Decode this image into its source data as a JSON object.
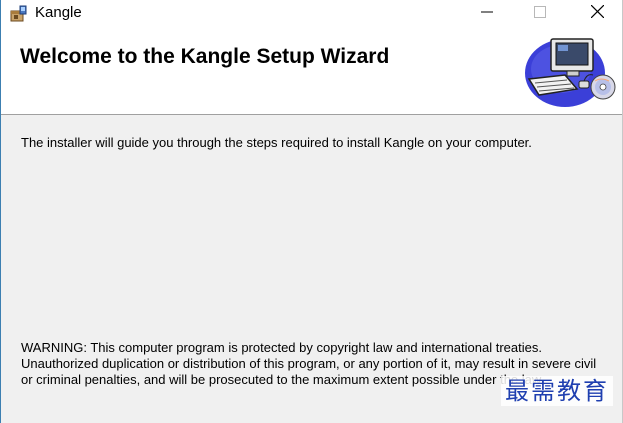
{
  "window": {
    "title": "Kangle",
    "icon": "installer-box-icon",
    "controls": {
      "minimize": "minimize-icon",
      "maximize": "maximize-icon",
      "close": "close-icon"
    }
  },
  "header": {
    "title": "Welcome to the Kangle Setup Wizard",
    "image": "computer-cd-banner-icon"
  },
  "body": {
    "intro": "The installer will guide you through the steps required to install Kangle on your computer.",
    "warning_lines": [
      "WARNING: This computer program is protected by copyright law and international treaties.",
      "Unauthorized duplication or distribution of this program, or any portion of it, may result in severe civil",
      "or criminal penalties, and will be prosecuted to the maximum extent possible under the law."
    ]
  },
  "watermark": {
    "text": "最需教育"
  },
  "colors": {
    "window_bg": "#f0f0f0",
    "header_bg": "#ffffff",
    "watermark": "#1f3fb0",
    "accent_border": "#3c7fb1"
  }
}
